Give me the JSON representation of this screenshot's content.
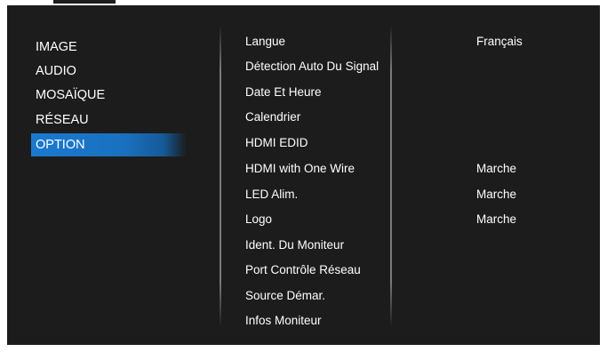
{
  "menu": {
    "items": [
      {
        "label": "IMAGE"
      },
      {
        "label": "AUDIO"
      },
      {
        "label": "MOSAÏQUE"
      },
      {
        "label": "RÉSEAU"
      },
      {
        "label": "OPTION"
      }
    ],
    "selected": "OPTION"
  },
  "submenu": {
    "items": [
      {
        "label": "Langue"
      },
      {
        "label": "Détection Auto Du Signal"
      },
      {
        "label": "Date Et Heure"
      },
      {
        "label": "Calendrier"
      },
      {
        "label": "HDMI EDID"
      },
      {
        "label": "HDMI with One Wire"
      },
      {
        "label": "LED Alim."
      },
      {
        "label": "Logo"
      },
      {
        "label": "Ident. Du Moniteur"
      },
      {
        "label": "Port Contrôle Réseau"
      },
      {
        "label": "Source Démar."
      },
      {
        "label": "Infos Moniteur"
      }
    ]
  },
  "values": {
    "langue": "Français",
    "hdmi_one_wire": "Marche",
    "led_alim": "Marche",
    "logo": "Marche"
  },
  "colors": {
    "background": "#1c1c1c",
    "selected_highlight": "#1a7ad0",
    "text": "#ffffff"
  }
}
